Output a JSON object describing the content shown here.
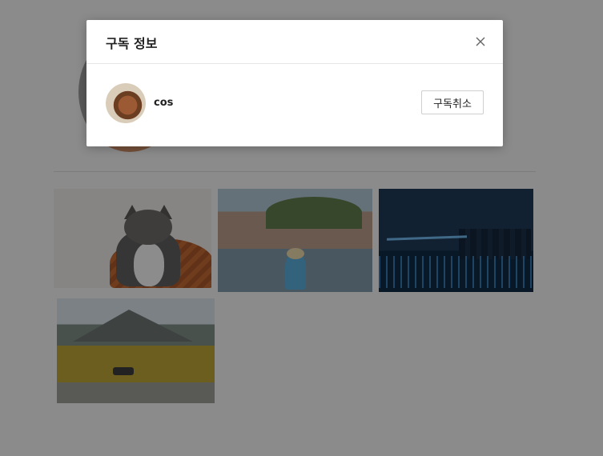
{
  "modal": {
    "title": "구독 정보",
    "close_icon": "close-icon",
    "subscription": {
      "username": "cos",
      "unsubscribe_label": "구독취소"
    }
  },
  "gallery": {
    "photos": [
      "cat",
      "seaside-town",
      "city-night",
      "mountain-road"
    ]
  },
  "colors": {
    "overlay": "rgba(0,0,0,0.42)",
    "modal_bg": "#ffffff",
    "text": "#222222",
    "button_border": "#cfcfcf"
  }
}
